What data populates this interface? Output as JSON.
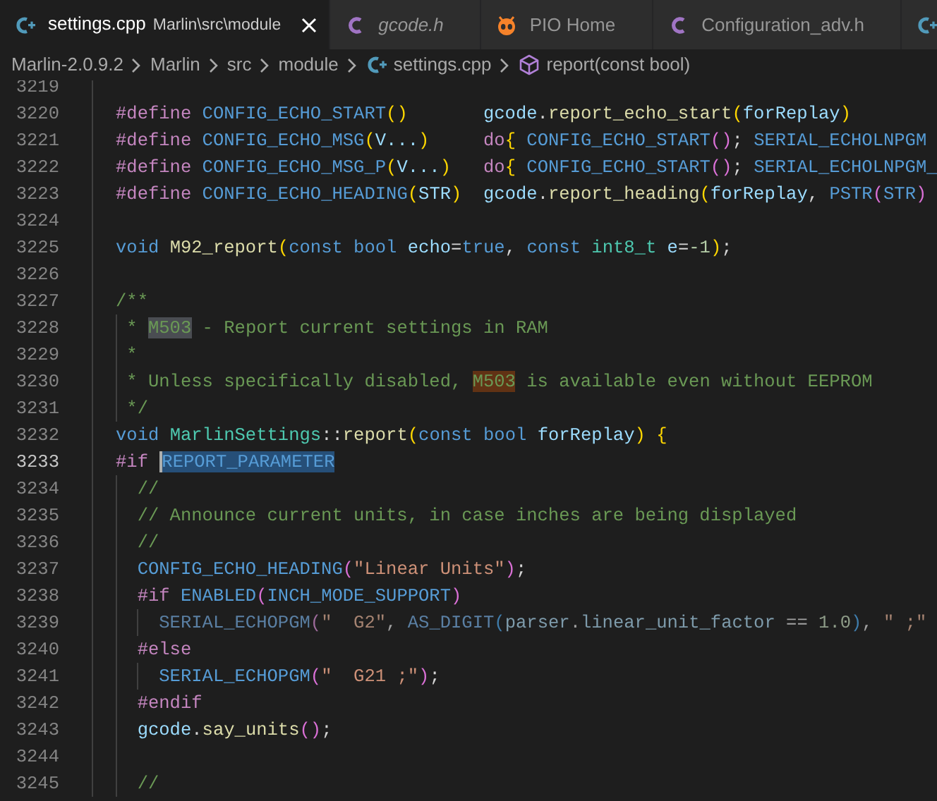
{
  "tabs": [
    {
      "label": "settings.cpp",
      "description": "Marlin\\src\\module",
      "kind": "cpp",
      "selected": true,
      "preview": false
    },
    {
      "label": "gcode.h",
      "kind": "c",
      "selected": false,
      "preview": true
    },
    {
      "label": "PIO Home",
      "kind": "pio",
      "selected": false,
      "preview": false
    },
    {
      "label": "Configuration_adv.h",
      "kind": "c",
      "selected": false,
      "preview": false
    },
    {
      "kind": "cpp",
      "selected": false
    }
  ],
  "breadcrumb": [
    {
      "label": "Marlin-2.0.9.2"
    },
    {
      "label": "Marlin"
    },
    {
      "label": "src"
    },
    {
      "label": "module"
    },
    {
      "label": "settings.cpp",
      "kind": "cpp"
    },
    {
      "label": "report(const bool)",
      "kind": "symbol"
    }
  ],
  "editor": {
    "lines": [
      {
        "number": "3219",
        "current": false
      },
      {
        "number": "3220",
        "current": false,
        "inactive": false,
        "tokens": [
          {
            "kind": "dir",
            "text": "#define "
          },
          {
            "kind": "mac",
            "text": "CONFIG_ECHO_START"
          },
          {
            "kind": "b1",
            "text": "()       "
          },
          {
            "kind": "var",
            "text": "gcode"
          },
          {
            "kind": "p",
            "text": "."
          },
          {
            "kind": "fn",
            "text": "report_echo_start"
          },
          {
            "kind": "b1",
            "text": "("
          },
          {
            "kind": "var",
            "text": "forReplay"
          },
          {
            "kind": "b1",
            "text": ")"
          }
        ]
      },
      {
        "number": "3221",
        "current": false,
        "inactive": false,
        "tokens": [
          {
            "kind": "dir",
            "text": "#define "
          },
          {
            "kind": "mac",
            "text": "CONFIG_ECHO_MSG"
          },
          {
            "kind": "b1",
            "text": "("
          },
          {
            "kind": "var",
            "text": "V..."
          },
          {
            "kind": "b1",
            "text": ")     "
          },
          {
            "kind": "ctl",
            "text": "do"
          },
          {
            "kind": "b1",
            "text": "{ "
          },
          {
            "kind": "mac",
            "text": "CONFIG_ECHO_START"
          },
          {
            "kind": "b2",
            "text": "()"
          },
          {
            "kind": "p",
            "text": "; "
          },
          {
            "kind": "mac",
            "text": "SERIAL_ECHOLNPGM"
          }
        ]
      },
      {
        "number": "3222",
        "current": false,
        "inactive": false,
        "tokens": [
          {
            "kind": "dir",
            "text": "#define "
          },
          {
            "kind": "mac",
            "text": "CONFIG_ECHO_MSG_P"
          },
          {
            "kind": "b1",
            "text": "("
          },
          {
            "kind": "var",
            "text": "V..."
          },
          {
            "kind": "b1",
            "text": ")   "
          },
          {
            "kind": "ctl",
            "text": "do"
          },
          {
            "kind": "b1",
            "text": "{ "
          },
          {
            "kind": "mac",
            "text": "CONFIG_ECHO_START"
          },
          {
            "kind": "b2",
            "text": "()"
          },
          {
            "kind": "p",
            "text": "; "
          },
          {
            "kind": "mac",
            "text": "SERIAL_ECHOLNPGM_"
          }
        ]
      },
      {
        "number": "3223",
        "current": false,
        "inactive": false,
        "tokens": [
          {
            "kind": "dir",
            "text": "#define "
          },
          {
            "kind": "mac",
            "text": "CONFIG_ECHO_HEADING"
          },
          {
            "kind": "b1",
            "text": "("
          },
          {
            "kind": "var",
            "text": "STR"
          },
          {
            "kind": "b1",
            "text": ")  "
          },
          {
            "kind": "var",
            "text": "gcode"
          },
          {
            "kind": "p",
            "text": "."
          },
          {
            "kind": "fn",
            "text": "report_heading"
          },
          {
            "kind": "b1",
            "text": "("
          },
          {
            "kind": "var",
            "text": "forReplay"
          },
          {
            "kind": "p",
            "text": ", "
          },
          {
            "kind": "mac",
            "text": "PSTR"
          },
          {
            "kind": "b2",
            "text": "("
          },
          {
            "kind": "mac",
            "text": "STR"
          },
          {
            "kind": "b2",
            "text": ")"
          }
        ]
      },
      {
        "number": "3224",
        "current": false
      },
      {
        "number": "3225",
        "current": false,
        "inactive": false,
        "tokens": [
          {
            "kind": "kw",
            "text": "void "
          },
          {
            "kind": "fn",
            "text": "M92_report"
          },
          {
            "kind": "b1",
            "text": "("
          },
          {
            "kind": "kw",
            "text": "const bool "
          },
          {
            "kind": "var",
            "text": "echo"
          },
          {
            "kind": "p",
            "text": "="
          },
          {
            "kind": "kw",
            "text": "true"
          },
          {
            "kind": "p",
            "text": ", "
          },
          {
            "kind": "kw",
            "text": "const "
          },
          {
            "kind": "type",
            "text": "int8_t "
          },
          {
            "kind": "var",
            "text": "e"
          },
          {
            "kind": "p",
            "text": "="
          },
          {
            "kind": "num",
            "text": "-1"
          },
          {
            "kind": "b1",
            "text": ")"
          },
          {
            "kind": "p",
            "text": ";"
          }
        ]
      },
      {
        "number": "3226",
        "current": false
      },
      {
        "number": "3227",
        "current": false,
        "inactive": false,
        "tokens": [
          {
            "kind": "com",
            "text": "/**"
          }
        ]
      },
      {
        "number": "3228",
        "current": false,
        "inactive": false,
        "tokens": [
          {
            "kind": "com",
            "text": " * "
          },
          {
            "kind": "com",
            "text": "M503",
            "match": true
          },
          {
            "kind": "com",
            "text": " - Report current settings in RAM"
          }
        ]
      },
      {
        "number": "3229",
        "current": false,
        "inactive": false,
        "tokens": [
          {
            "kind": "com",
            "text": " *"
          }
        ]
      },
      {
        "number": "3230",
        "current": false,
        "inactive": false,
        "tokens": [
          {
            "kind": "com",
            "text": " * Unless specifically disabled, "
          },
          {
            "kind": "com",
            "text": "M503",
            "find_result": true
          },
          {
            "kind": "com",
            "text": " is available even without EEPROM"
          }
        ]
      },
      {
        "number": "3231",
        "current": false,
        "inactive": false,
        "tokens": [
          {
            "kind": "com",
            "text": " */"
          }
        ]
      },
      {
        "number": "3232",
        "current": false,
        "inactive": false,
        "tokens": [
          {
            "kind": "kw",
            "text": "void "
          },
          {
            "kind": "type",
            "text": "MarlinSettings"
          },
          {
            "kind": "p",
            "text": "::"
          },
          {
            "kind": "fn",
            "text": "report"
          },
          {
            "kind": "b1",
            "text": "("
          },
          {
            "kind": "kw",
            "text": "const bool "
          },
          {
            "kind": "var",
            "text": "forReplay"
          },
          {
            "kind": "b1",
            "text": ") {"
          }
        ]
      },
      {
        "number": "3233",
        "current": true,
        "inactive": false,
        "tokens": [
          {
            "kind": "dir",
            "text": "#if "
          },
          {
            "kind": "mac",
            "text": "REPORT_PARAMETER",
            "selected": true
          }
        ]
      },
      {
        "number": "3234",
        "current": false,
        "inactive": false,
        "tokens": [
          {
            "kind": "com",
            "text": "  //"
          }
        ]
      },
      {
        "number": "3235",
        "current": false,
        "inactive": false,
        "tokens": [
          {
            "kind": "com",
            "text": "  // Announce current units, in case inches are being displayed"
          }
        ]
      },
      {
        "number": "3236",
        "current": false,
        "inactive": false,
        "tokens": [
          {
            "kind": "com",
            "text": "  //"
          }
        ]
      },
      {
        "number": "3237",
        "current": false,
        "inactive": false,
        "tokens": [
          {
            "kind": "mac",
            "text": "  CONFIG_ECHO_HEADING"
          },
          {
            "kind": "b2",
            "text": "("
          },
          {
            "kind": "str",
            "text": "\"Linear Units\""
          },
          {
            "kind": "b2",
            "text": ")"
          },
          {
            "kind": "p",
            "text": ";"
          }
        ]
      },
      {
        "number": "3238",
        "current": false,
        "inactive": false,
        "tokens": [
          {
            "kind": "dir",
            "text": "  #if "
          },
          {
            "kind": "mac",
            "text": "ENABLED"
          },
          {
            "kind": "b2",
            "text": "("
          },
          {
            "kind": "mac",
            "text": "INCH_MODE_SUPPORT"
          },
          {
            "kind": "b2",
            "text": ")"
          }
        ]
      },
      {
        "number": "3239",
        "current": false,
        "inactive": true,
        "tokens": [
          {
            "kind": "mac",
            "text": "    SERIAL_ECHOPGM"
          },
          {
            "kind": "b2",
            "text": "("
          },
          {
            "kind": "str",
            "text": "\"  G2\""
          },
          {
            "kind": "p",
            "text": ", "
          },
          {
            "kind": "mac",
            "text": "AS_DIGIT"
          },
          {
            "kind": "b3",
            "text": "("
          },
          {
            "kind": "var",
            "text": "parser"
          },
          {
            "kind": "p",
            "text": "."
          },
          {
            "kind": "var",
            "text": "linear_unit_factor"
          },
          {
            "kind": "p",
            "text": " == "
          },
          {
            "kind": "num",
            "text": "1.0"
          },
          {
            "kind": "b3",
            "text": ")"
          },
          {
            "kind": "p",
            "text": ", "
          },
          {
            "kind": "str",
            "text": "\" ;\""
          }
        ]
      },
      {
        "number": "3240",
        "current": false,
        "inactive": false,
        "tokens": [
          {
            "kind": "dir",
            "text": "  #else"
          }
        ]
      },
      {
        "number": "3241",
        "current": false,
        "inactive": false,
        "tokens": [
          {
            "kind": "mac",
            "text": "    SERIAL_ECHOPGM"
          },
          {
            "kind": "b2",
            "text": "("
          },
          {
            "kind": "str",
            "text": "\"  G21 ;\""
          },
          {
            "kind": "b2",
            "text": ")"
          },
          {
            "kind": "p",
            "text": ";"
          }
        ]
      },
      {
        "number": "3242",
        "current": false,
        "inactive": false,
        "tokens": [
          {
            "kind": "dir",
            "text": "  #endif"
          }
        ]
      },
      {
        "number": "3243",
        "current": false,
        "inactive": false,
        "tokens": [
          {
            "kind": "var",
            "text": "  gcode"
          },
          {
            "kind": "p",
            "text": "."
          },
          {
            "kind": "fn",
            "text": "say_units"
          },
          {
            "kind": "b2",
            "text": "()"
          },
          {
            "kind": "p",
            "text": ";"
          }
        ]
      },
      {
        "number": "3244",
        "current": false
      },
      {
        "number": "3245",
        "current": false,
        "inactive": false,
        "tokens": [
          {
            "kind": "com",
            "text": "  //"
          }
        ]
      }
    ]
  }
}
